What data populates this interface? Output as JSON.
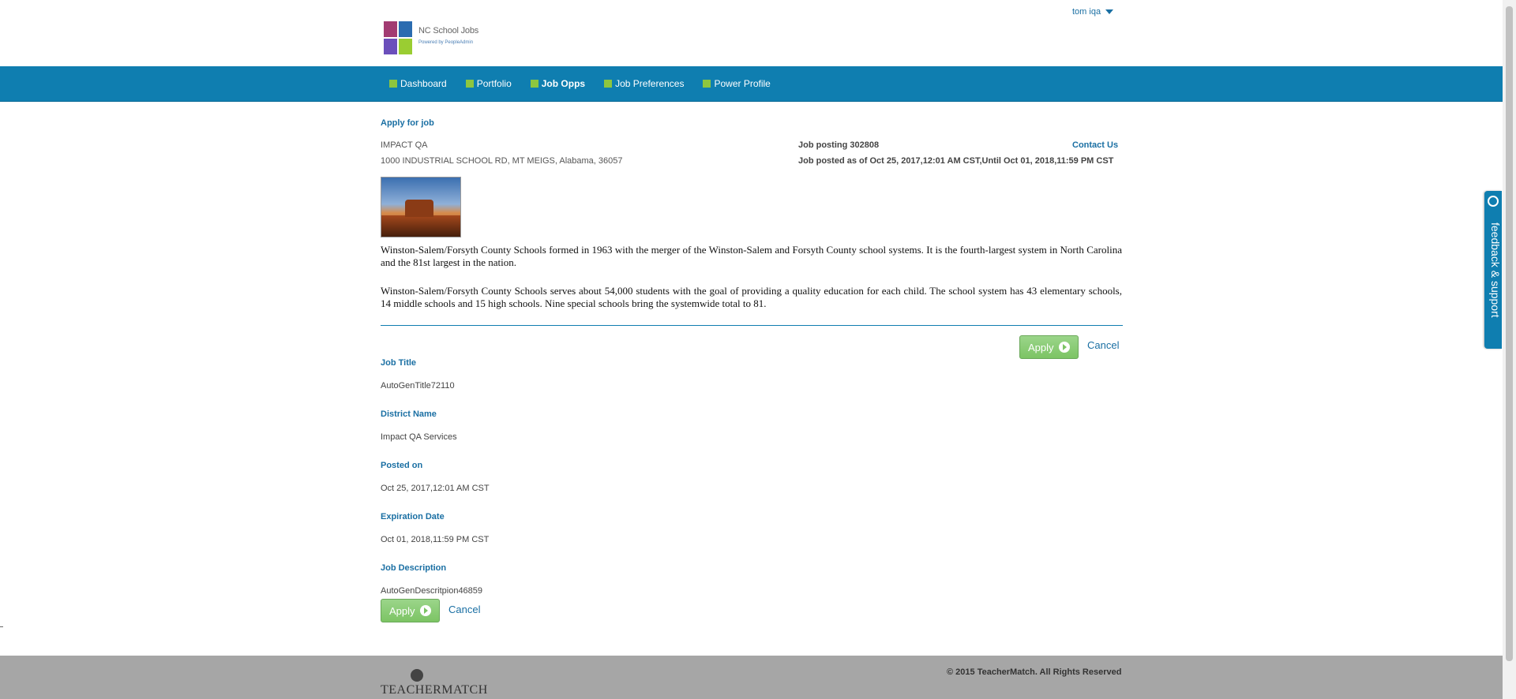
{
  "header": {
    "logo_name": "NC School Jobs",
    "logo_sub": "Powered by PeopleAdmin",
    "user_name": "tom iqa"
  },
  "nav": {
    "items": [
      {
        "label": "Dashboard"
      },
      {
        "label": "Portfolio"
      },
      {
        "label": "Job Opps"
      },
      {
        "label": "Job Preferences"
      },
      {
        "label": "Power Profile"
      }
    ]
  },
  "job": {
    "page_title": "Apply for job",
    "org_name": "IMPACT QA",
    "org_address": "1000 INDUSTRIAL SCHOOL RD, MT MEIGS, Alabama, 36057",
    "posting_number": "Job posting 302808",
    "posting_dates": "Job posted as of Oct 25, 2017,12:01 AM CST,Until Oct 01, 2018,11:59 PM CST",
    "contact_label": "Contact Us",
    "paragraph_1": "Winston-Salem/Forsyth County Schools formed in 1963 with the merger of the Winston-Salem and Forsyth County school systems. It is the fourth-largest system in North Carolina and the 81st largest in the nation.",
    "paragraph_2": "Winston-Salem/Forsyth County Schools serves about 54,000 students with the goal of providing a quality education for each child. The school system has 43 elementary schools, 14 middle schools and 15 high schools. Nine special schools bring the systemwide total to 81."
  },
  "actions": {
    "apply_label": "Apply",
    "cancel_label": "Cancel"
  },
  "fields": {
    "job_title_label": "Job Title",
    "job_title_value": "AutoGenTitle72110",
    "district_label": "District Name",
    "district_value": "Impact QA Services",
    "posted_label": "Posted on",
    "posted_value": "Oct 25, 2017,12:01 AM CST",
    "expiration_label": "Expiration Date",
    "expiration_value": "Oct 01, 2018,11:59 PM CST",
    "description_label": "Job Description",
    "description_value": "AutoGenDescritpion46859"
  },
  "feedback": {
    "label": "feedback & support"
  },
  "footer": {
    "brand": "TEACHERMATCH",
    "copyright": "© 2015 TeacherMatch. All Rights Reserved"
  },
  "colors": {
    "nav_bg": "#0f7eb0",
    "link": "#1a6fa3",
    "nav_bullet": "#8dc63f",
    "apply_button": "#7cc464",
    "footer_bg": "#a6a6a6"
  }
}
